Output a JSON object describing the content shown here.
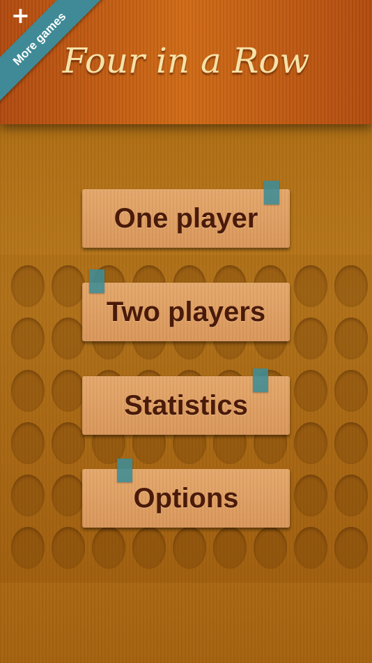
{
  "header": {
    "title": "Four in a Row",
    "more_games_plus": "+",
    "more_games_label": "More games"
  },
  "menu": {
    "items": [
      {
        "label": "One player"
      },
      {
        "label": "Two players"
      },
      {
        "label": "Statistics"
      },
      {
        "label": "Options"
      }
    ]
  },
  "colors": {
    "header": "#c45e12",
    "background": "#b06e16",
    "button": "#e0a066",
    "button_text": "#4a1a0a",
    "title_text": "#f6e2a8",
    "ribbon": "#3f8a96"
  }
}
